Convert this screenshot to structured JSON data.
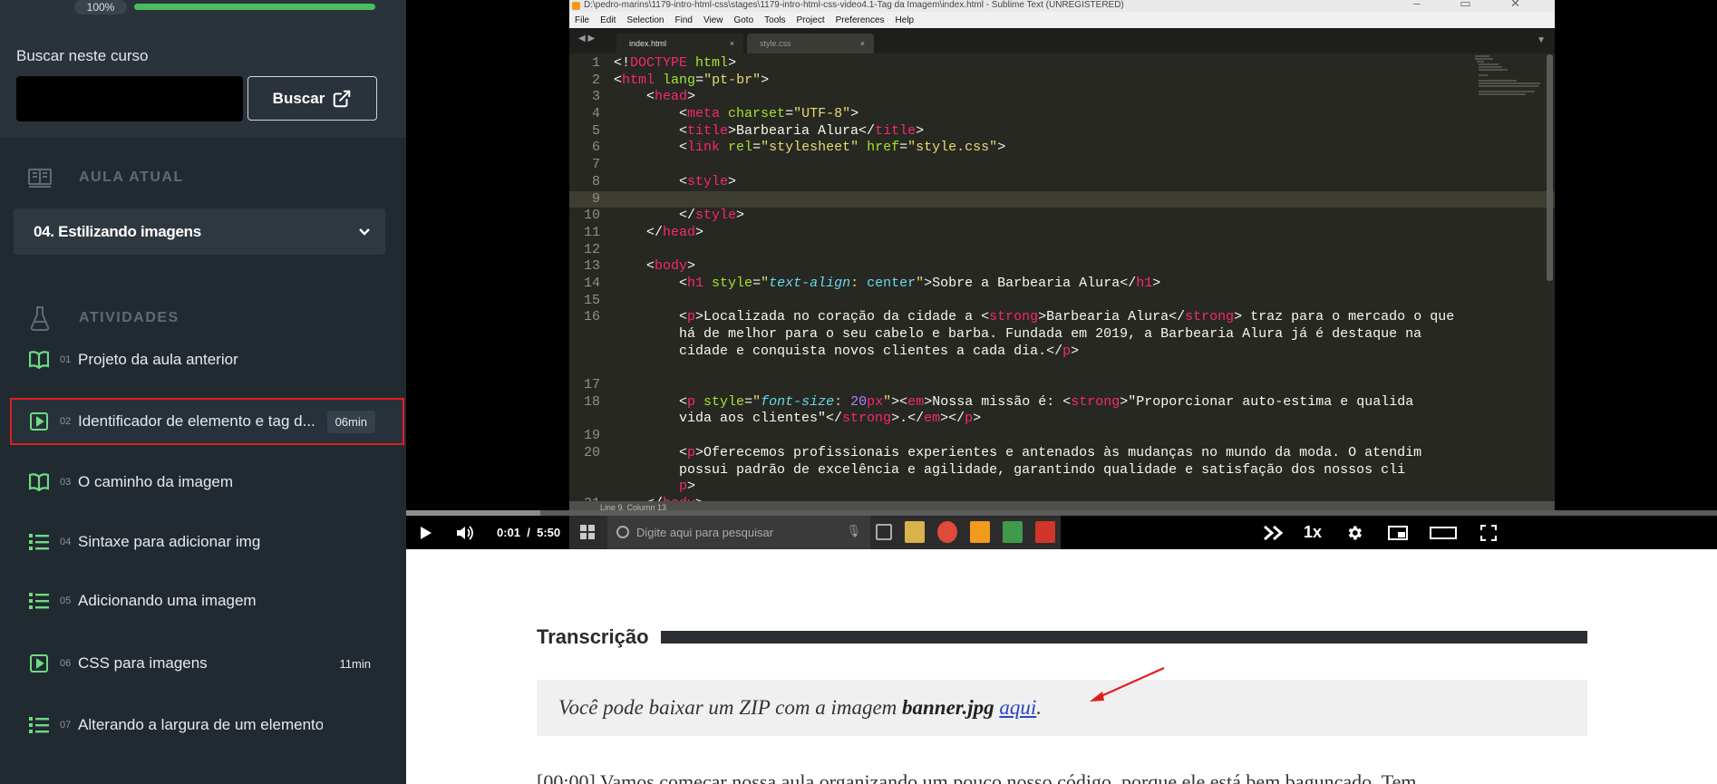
{
  "sidebar": {
    "progress_label": "100%",
    "progress_fraction": 1.0,
    "search_label": "Buscar neste curso",
    "search_value": "",
    "search_button": "Buscar",
    "current_section": "AULA ATUAL",
    "current_lesson": "04. Estilizando imagens",
    "activities_section": "ATIVIDADES",
    "activities": [
      {
        "num": "01",
        "title": "Projeto da aula anterior",
        "icon": "book-icon",
        "duration": ""
      },
      {
        "num": "02",
        "title": "Identificador de elemento e tag d...",
        "icon": "play-icon",
        "duration": "06min"
      },
      {
        "num": "03",
        "title": "O caminho da imagem",
        "icon": "book-icon",
        "duration": ""
      },
      {
        "num": "04",
        "title": "Sintaxe para adicionar img",
        "icon": "list-icon",
        "duration": ""
      },
      {
        "num": "05",
        "title": "Adicionando uma imagem",
        "icon": "list-icon",
        "duration": ""
      },
      {
        "num": "06",
        "title": "CSS para imagens",
        "icon": "play-icon",
        "duration": "11min"
      },
      {
        "num": "07",
        "title": "Alterando a largura de um elemento",
        "icon": "list-icon",
        "duration": ""
      }
    ]
  },
  "editor": {
    "window_title": "D:\\pedro-marins\\1179-intro-html-css\\stages\\1179-intro-html-css-video4.1-Tag da Imagem\\index.html - Sublime Text (UNREGISTERED)",
    "menu": [
      "File",
      "Edit",
      "Selection",
      "Find",
      "View",
      "Goto",
      "Tools",
      "Project",
      "Preferences",
      "Help"
    ],
    "tabs": [
      "index.html",
      "style.css"
    ],
    "status": "Line 9, Column 13"
  },
  "player": {
    "current_time": "0:01",
    "separator": "/",
    "duration": "5:50",
    "speed": "1x",
    "progress_fraction": 0.003,
    "taskbar_search_placeholder": "Digite aqui para pesquisar"
  },
  "transcript": {
    "heading": "Transcrição",
    "note_prefix": "Você pode baixar um ZIP com a imagem ",
    "note_file": "banner.jpg",
    "note_link": "aqui",
    "note_suffix": ".",
    "first_line": "[00:00] Vamos começar nossa aula organizando um pouco nosso código, porque ele está bem bagunçado. Tem"
  },
  "colors": {
    "sidebar_bg": "#222a31",
    "progress_green": "#4cbd5c",
    "activity_icon_green": "#6ddc82",
    "selected_border": "#e01e1e"
  }
}
